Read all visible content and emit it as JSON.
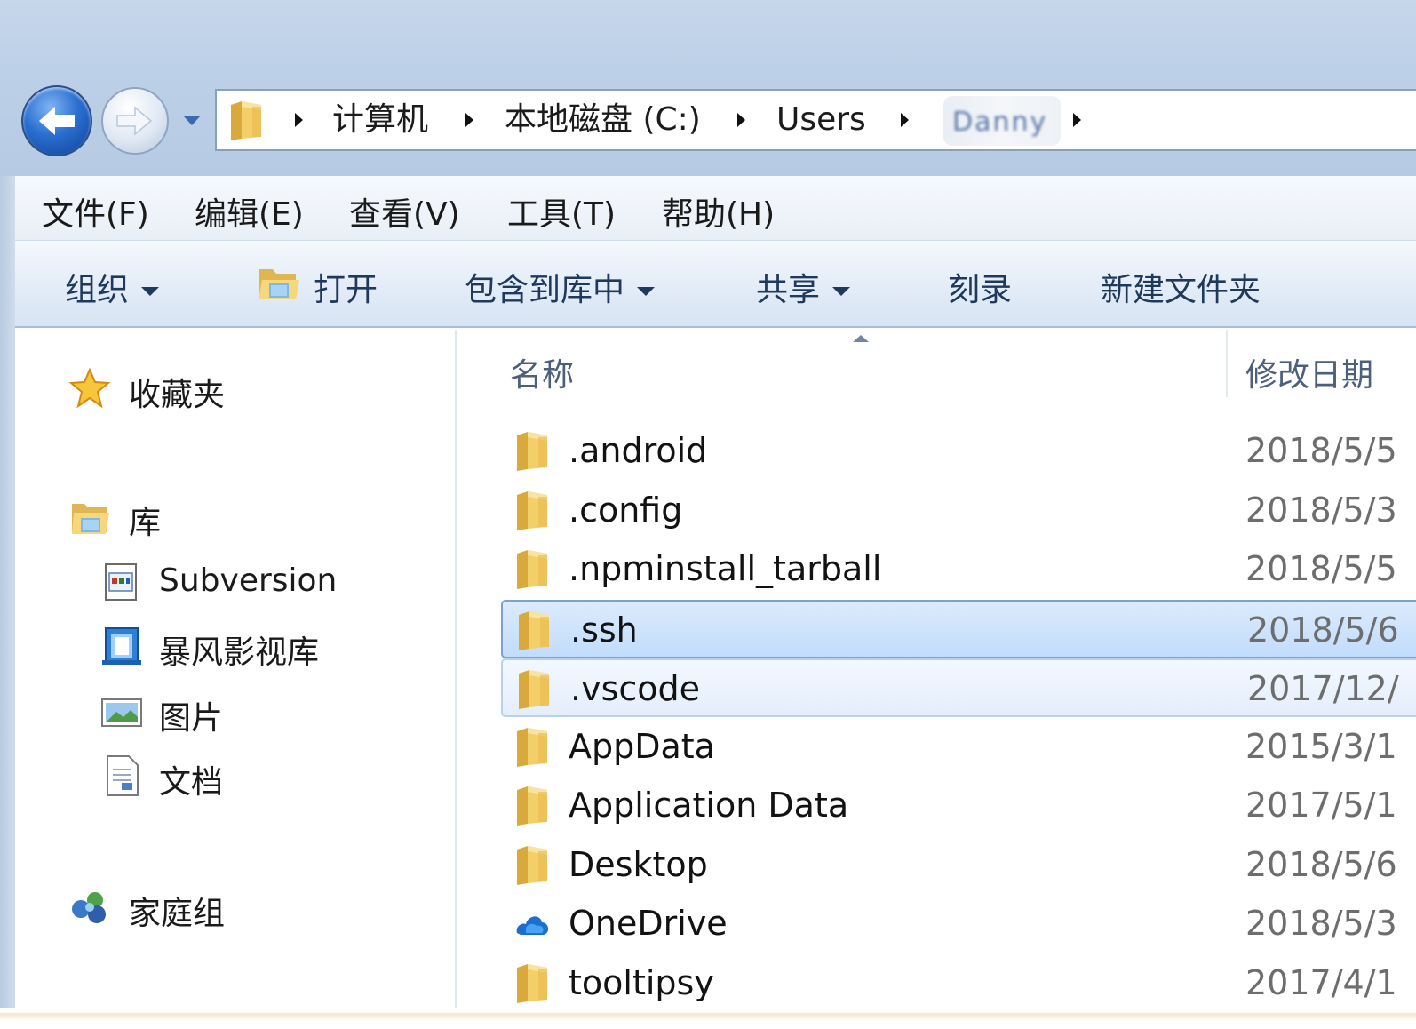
{
  "address_bar": {
    "crumbs": [
      "计算机",
      "本地磁盘 (C:)",
      "Users",
      "Danny"
    ]
  },
  "menu": {
    "file": "文件(F)",
    "edit": "编辑(E)",
    "view": "查看(V)",
    "tools": "工具(T)",
    "help": "帮助(H)"
  },
  "toolbar": {
    "organize": "组织",
    "open": "打开",
    "include_in_library": "包含到库中",
    "share": "共享",
    "burn": "刻录",
    "new_folder": "新建文件夹"
  },
  "nav_pane": {
    "favorites": "收藏夹",
    "libraries": "库",
    "library_items": [
      "Subversion",
      "暴风影视库",
      "图片",
      "文档"
    ],
    "homegroup": "家庭组"
  },
  "columns": {
    "name": "名称",
    "date_modified": "修改日期"
  },
  "files": [
    {
      "name": ".android",
      "date": "2018/5/5",
      "icon": "folder-icon"
    },
    {
      "name": ".config",
      "date": "2018/5/3",
      "icon": "folder-icon"
    },
    {
      "name": ".npminstall_tarball",
      "date": "2018/5/5",
      "icon": "folder-icon"
    },
    {
      "name": ".ssh",
      "date": "2018/5/6",
      "icon": "folder-icon",
      "state": "selected"
    },
    {
      "name": ".vscode",
      "date": "2017/12/",
      "icon": "folder-icon",
      "state": "hover"
    },
    {
      "name": "AppData",
      "date": "2015/3/1",
      "icon": "folder-icon"
    },
    {
      "name": "Application Data",
      "date": "2017/5/1",
      "icon": "folder-icon"
    },
    {
      "name": "Desktop",
      "date": "2018/5/6",
      "icon": "folder-icon"
    },
    {
      "name": "OneDrive",
      "date": "2018/5/3",
      "icon": "onedrive-icon"
    },
    {
      "name": "tooltipsy",
      "date": "2017/4/1",
      "icon": "folder-icon"
    }
  ],
  "colors": {
    "accent": "#2a6fd0",
    "selection": "#c1dcfc",
    "selection_border": "#7da2ce",
    "chrome": "#bcd0e8"
  }
}
